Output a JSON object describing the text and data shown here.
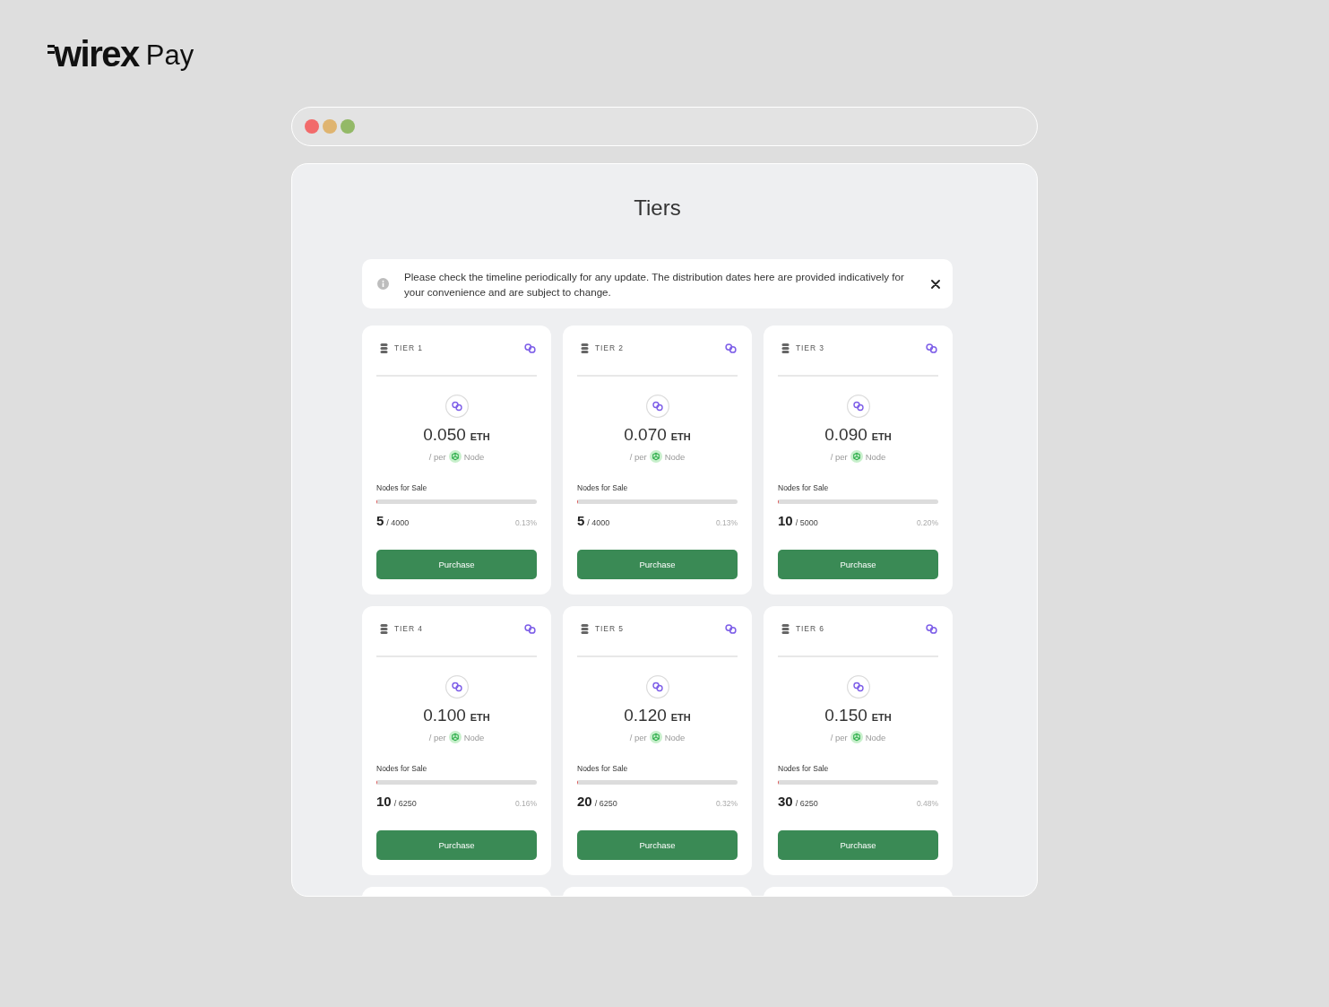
{
  "logo": {
    "wordmark": "wirex",
    "product": "Pay"
  },
  "page": {
    "title": "Tiers"
  },
  "notice": {
    "text": "Please check the timeline periodically for any update. The distribution dates here are provided indicatively for your convenience and are subject to change."
  },
  "tiers": [
    {
      "label": "TIER 1",
      "price": "0.050",
      "currency": "ETH",
      "per": "/ per",
      "unit": "Node",
      "sale_label": "Nodes for Sale",
      "level": 0.0013,
      "sold": "5",
      "total": "/ 4000",
      "percent": "0.13%",
      "button": "Purchase"
    },
    {
      "label": "TIER 2",
      "price": "0.070",
      "currency": "ETH",
      "per": "/ per",
      "unit": "Node",
      "sale_label": "Nodes for Sale",
      "level": 0.0013,
      "sold": "5",
      "total": "/ 4000",
      "percent": "0.13%",
      "button": "Purchase"
    },
    {
      "label": "TIER 3",
      "price": "0.090",
      "currency": "ETH",
      "per": "/ per",
      "unit": "Node",
      "sale_label": "Nodes for Sale",
      "level": 0.002,
      "sold": "10",
      "total": "/ 5000",
      "percent": "0.20%",
      "button": "Purchase"
    },
    {
      "label": "TIER 4",
      "price": "0.100",
      "currency": "ETH",
      "per": "/ per",
      "unit": "Node",
      "sale_label": "Nodes for Sale",
      "level": 0.0016,
      "sold": "10",
      "total": "/ 6250",
      "percent": "0.16%",
      "button": "Purchase"
    },
    {
      "label": "TIER 5",
      "price": "0.120",
      "currency": "ETH",
      "per": "/ per",
      "unit": "Node",
      "sale_label": "Nodes for Sale",
      "level": 0.0032,
      "sold": "20",
      "total": "/ 6250",
      "percent": "0.32%",
      "button": "Purchase"
    },
    {
      "label": "TIER 6",
      "price": "0.150",
      "currency": "ETH",
      "per": "/ per",
      "unit": "Node",
      "sale_label": "Nodes for Sale",
      "level": 0.0048,
      "sold": "30",
      "total": "/ 6250",
      "percent": "0.48%",
      "button": "Purchase"
    }
  ],
  "more_tiers_below": true
}
